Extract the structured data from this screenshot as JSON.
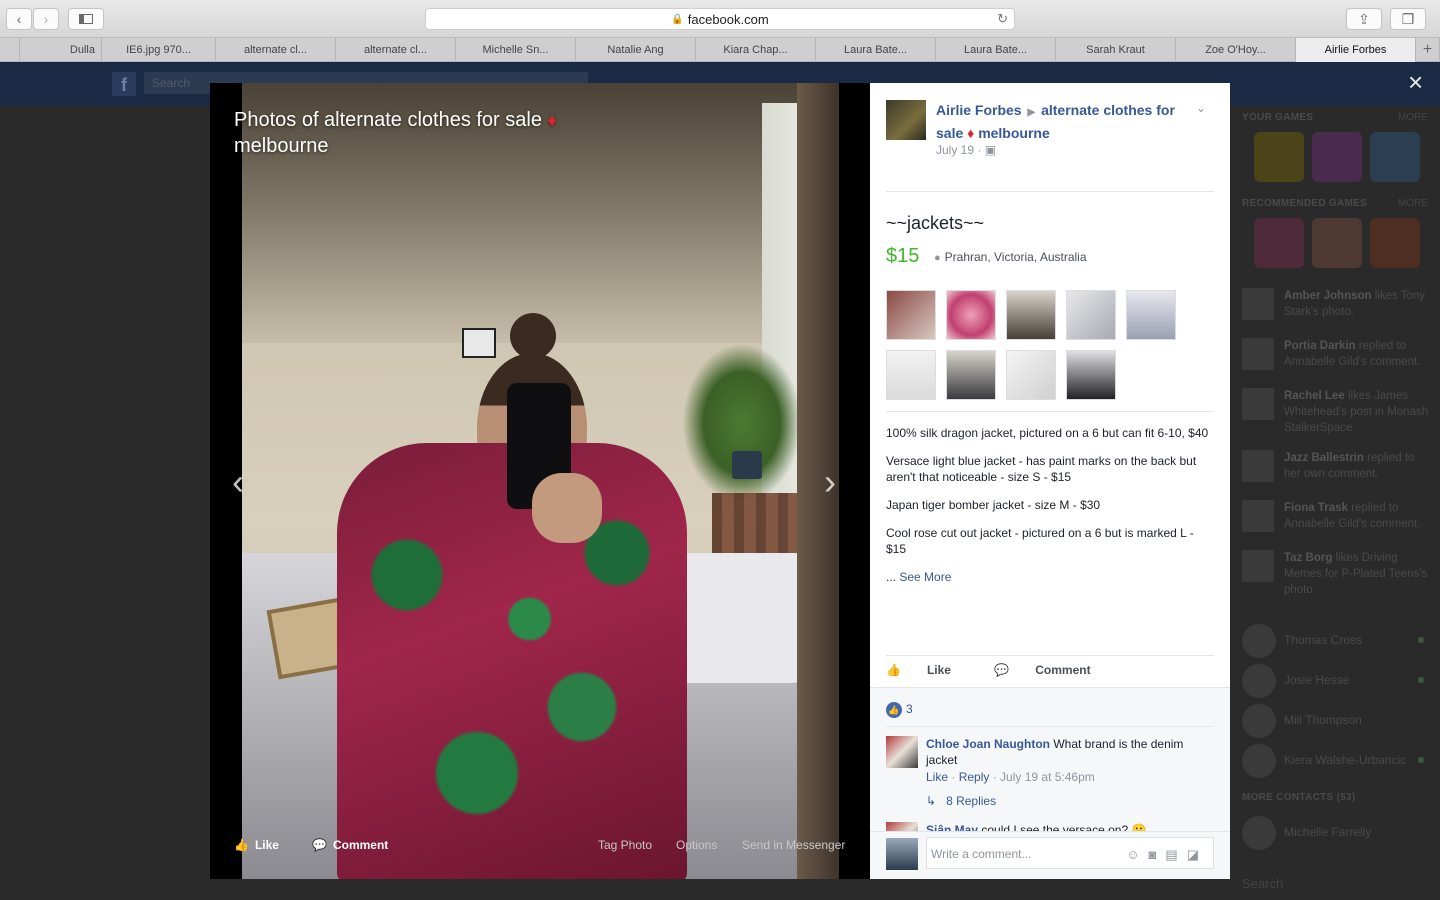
{
  "browser": {
    "url": "facebook.com",
    "tabs": [
      "",
      "Dulla",
      "IE6.jpg 970...",
      "alternate cl...",
      "alternate cl...",
      "Michelle Sn...",
      "Natalie Ang",
      "Kiara Chap...",
      "Laura Bate...",
      "Laura Bate...",
      "Sarah Kraut",
      "Zoe O'Hoy...",
      "Airlie Forbes"
    ],
    "active_tab_index": 12,
    "new_tab": "+"
  },
  "facebook": {
    "search_placeholder": "Search"
  },
  "viewer": {
    "title": "Photos of alternate clothes for sale",
    "title_suffix": "melbourne",
    "diamond": "♦",
    "actions": {
      "like": "Like",
      "comment": "Comment",
      "tag_photo": "Tag Photo",
      "options": "Options",
      "send": "Send in Messenger"
    },
    "close": "×",
    "prev": "‹",
    "next": "›"
  },
  "post": {
    "author": "Airlie Forbes",
    "group_name_part1": "alternate clothes for sale",
    "group_name_part2": "melbourne",
    "date": "July 19",
    "title": "~~jackets~~",
    "price": "$15",
    "location": "Prahran, Victoria, Australia",
    "description": [
      "100% silk dragon jacket, pictured on a 6 but can fit 6-10, $40",
      "Versace light blue jacket - has paint marks on the back but aren't that noticeable - size S - $15",
      "Japan tiger bomber jacket - size M - $30",
      "Cool rose cut out jacket - pictured on a 6 but is marked L - $15"
    ],
    "see_more_prefix": "... ",
    "see_more": "See More",
    "like_label": "Like",
    "comment_label": "Comment",
    "like_count": "3"
  },
  "comments": [
    {
      "name": "Chloe Joan Naughton",
      "text": "What brand is the denim jacket",
      "like": "Like",
      "reply": "Reply",
      "time": "July 19 at 5:46pm",
      "replies": "8 Replies"
    },
    {
      "name": "Siân May",
      "text": "could I see the versace on? 😬"
    }
  ],
  "write_comment_placeholder": "Write a comment...",
  "sidebar": {
    "your_games": "YOUR GAMES",
    "recommended_games": "RECOMMENDED GAMES",
    "more": "MORE",
    "activity": [
      {
        "name": "Amber Johnson",
        "text": "likes Tony Stark's photo."
      },
      {
        "name": "Portia Darkin",
        "text": "replied to Annabelle Gild's comment."
      },
      {
        "name": "Rachel Lee",
        "text": "likes James Whitehead's post in Monash StalkerSpace."
      },
      {
        "name": "Jazz Ballestrin",
        "text": "replied to her own comment."
      },
      {
        "name": "Fiona Trask",
        "text": "replied to Annabelle Gild's comment."
      },
      {
        "name": "Taz Borg",
        "text": "likes Driving Memes for P-Plated Teens's photo."
      }
    ],
    "contacts": [
      "Thomas Cross",
      "Josie Hesse",
      "Mili Thompson",
      "Kiera Walshe-Urbancic"
    ],
    "more_contacts": "MORE CONTACTS (53)",
    "more_contact_first": "Michelle Farrelly",
    "search": "Search"
  }
}
